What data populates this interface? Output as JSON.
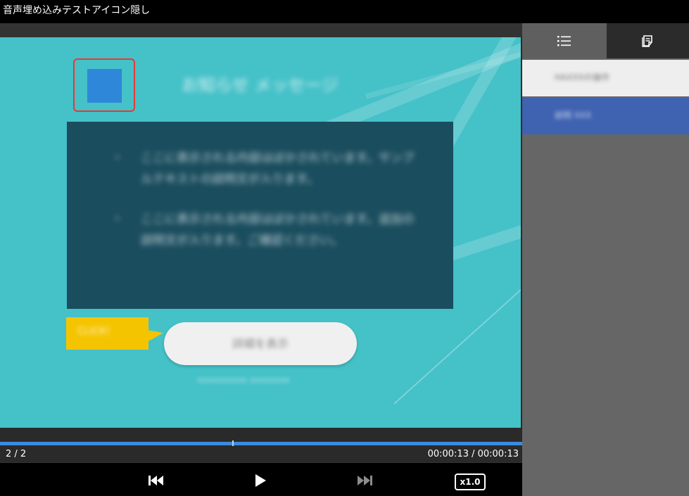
{
  "window": {
    "title": "音声埋め込みテストアイコン隠し"
  },
  "slide": {
    "title": "お知らせ メッセージ",
    "bullets": [
      {
        "dot": "・",
        "text": "ここに表示される内容はぼかされています。サンプルテキストの説明文が入ります。"
      },
      {
        "dot": "・",
        "text": "ここに表示される内容はぼかされています。追加の説明文が入ります。ご確認ください。"
      }
    ],
    "callout_label": "CLICK!",
    "button_label": "詳細を表示",
    "sub_caption": "xxxxxxxxxx xxxxxxxx"
  },
  "progress": {
    "fraction": 1.0
  },
  "status": {
    "slide_counter": "2 / 2",
    "time": "00:00:13 / 00:00:13"
  },
  "controls": {
    "prev_icon": "skip-previous-icon",
    "play_icon": "play-icon",
    "next_icon": "skip-next-icon",
    "speed_label": "x1.0"
  },
  "sidebar": {
    "tabs": [
      {
        "icon": "list-icon",
        "active": true
      },
      {
        "icon": "notes-icon",
        "active": false
      }
    ],
    "items": [
      {
        "label": "HAXXXの操作",
        "selected": false
      },
      {
        "label": "説明 XXX",
        "selected": true
      }
    ]
  },
  "colors": {
    "slide_bg": "#45c1c8",
    "text_panel": "#1a4d5e",
    "callout": "#f5c400",
    "icon_highlight": "#e53935",
    "icon_square": "#2f87d9",
    "progress": "#3a8be0",
    "sidebar_selected": "#3f62b1"
  }
}
